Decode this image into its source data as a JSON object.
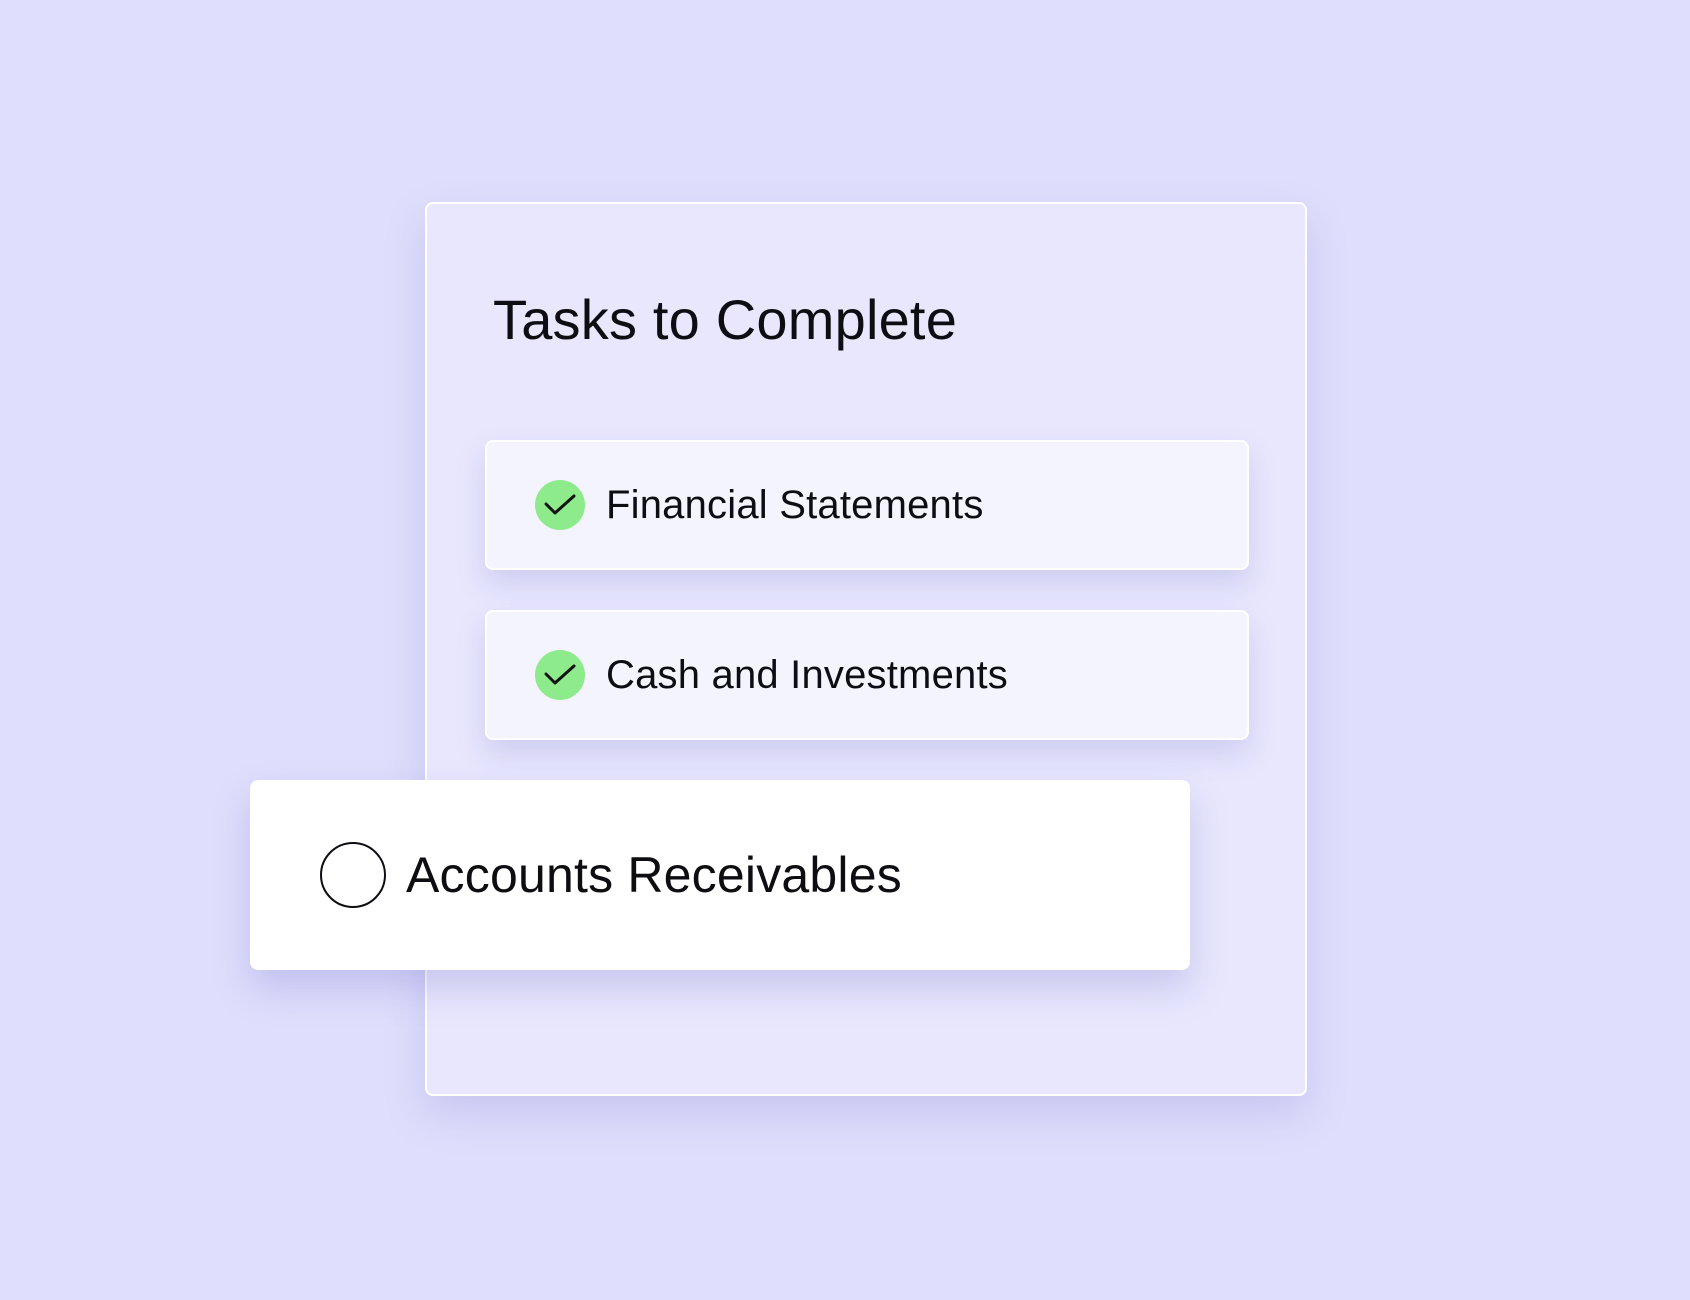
{
  "panel": {
    "title": "Tasks to Complete"
  },
  "tasks": [
    {
      "label": "Financial Statements",
      "status": "completed",
      "icon": "checkmark-icon"
    },
    {
      "label": "Cash and Investments",
      "status": "completed",
      "icon": "checkmark-icon"
    },
    {
      "label": "Accounts Receivables",
      "status": "pending",
      "icon": "empty-circle-icon"
    }
  ],
  "colors": {
    "background": "#dfdefc",
    "panel": "#e8e7fd",
    "card": "#f4f4fe",
    "check": "#8eeb8b",
    "text": "#0d0d12"
  }
}
